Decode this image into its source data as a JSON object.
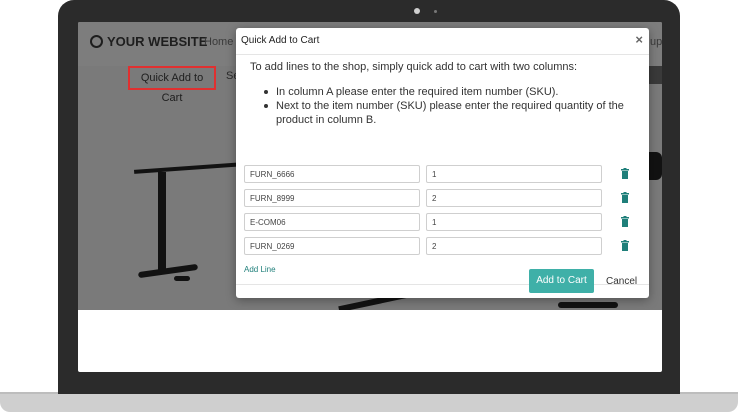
{
  "site": {
    "logo": "YOUR WEBSITE",
    "nav_home": "Home",
    "nav_right_partial": "up",
    "quick_add_link": "Quick Add to Cart",
    "partial_text": "Se"
  },
  "modal": {
    "title": "Quick Add to Cart",
    "close": "×",
    "intro": "To add lines to the shop, simply quick add to cart with two columns:",
    "bullets": [
      "In column A please enter the required item number (SKU).",
      "Next to the item number (SKU) please enter the required quantity of the product in column B."
    ],
    "rows": [
      {
        "sku": "FURN_6666",
        "qty": "1"
      },
      {
        "sku": "FURN_8999",
        "qty": "2"
      },
      {
        "sku": "E-COM06",
        "qty": "1"
      },
      {
        "sku": "FURN_0269",
        "qty": "2"
      }
    ],
    "add_line": "Add Line",
    "add_to_cart": "Add to Cart",
    "cancel": "Cancel"
  },
  "colors": {
    "accent": "#3fb0a8",
    "trash": "#1f7f7a",
    "highlight_border": "#e03030"
  }
}
